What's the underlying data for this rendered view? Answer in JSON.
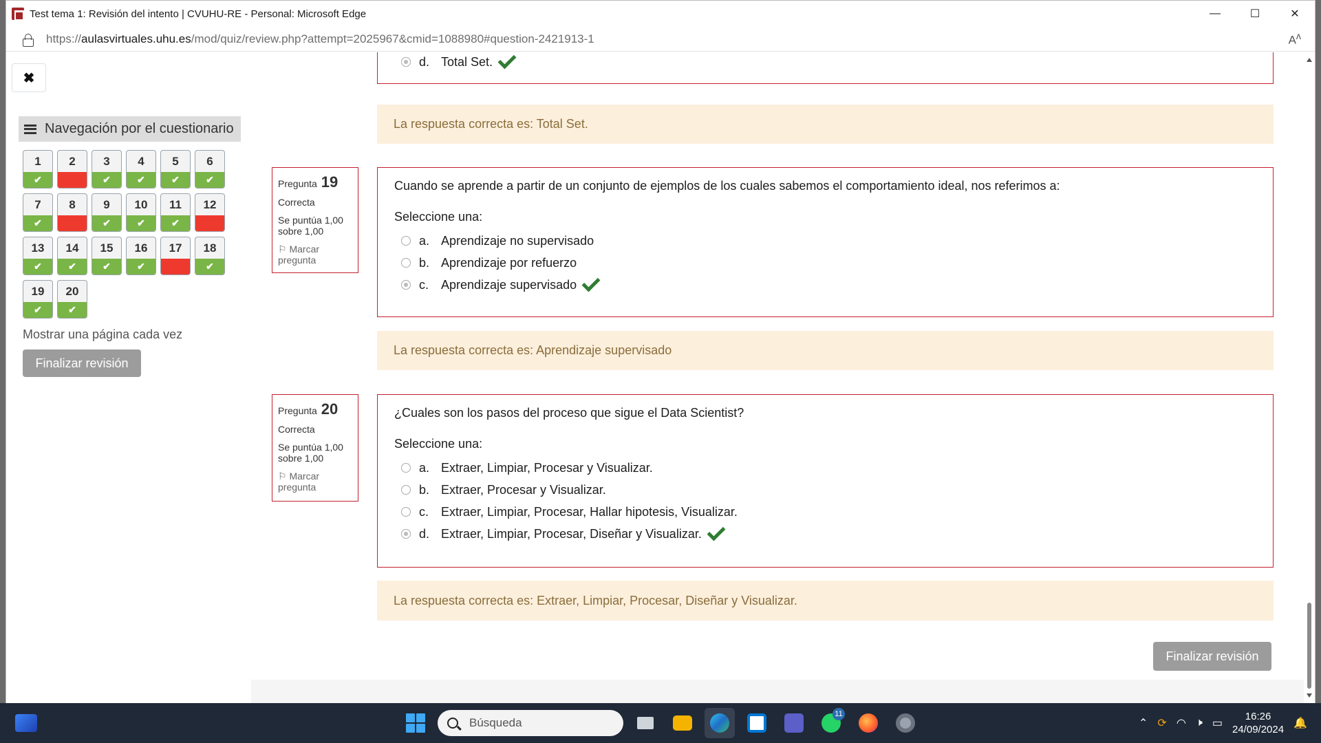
{
  "browser": {
    "title": "Test tema 1: Revisión del intento | CVUHU-RE - Personal: Microsoft Edge",
    "url_prefix": "https://",
    "url_host": "aulasvirtuales.uhu.es",
    "url_path": "/mod/quiz/review.php?attempt=2025967&cmid=1088980#question-2421913-1",
    "minimize": "—",
    "maximize": "☐",
    "close": "✕",
    "read_aloud": "Aͅ"
  },
  "drawer": {
    "close_label": "✖",
    "nav_title": "Navegación por el cuestionario",
    "questions": [
      {
        "n": "1",
        "status": "correct"
      },
      {
        "n": "2",
        "status": "incorrect"
      },
      {
        "n": "3",
        "status": "correct"
      },
      {
        "n": "4",
        "status": "correct"
      },
      {
        "n": "5",
        "status": "correct"
      },
      {
        "n": "6",
        "status": "correct"
      },
      {
        "n": "7",
        "status": "correct"
      },
      {
        "n": "8",
        "status": "incorrect"
      },
      {
        "n": "9",
        "status": "correct"
      },
      {
        "n": "10",
        "status": "correct"
      },
      {
        "n": "11",
        "status": "correct"
      },
      {
        "n": "12",
        "status": "incorrect"
      },
      {
        "n": "13",
        "status": "correct"
      },
      {
        "n": "14",
        "status": "correct"
      },
      {
        "n": "15",
        "status": "correct"
      },
      {
        "n": "16",
        "status": "correct"
      },
      {
        "n": "17",
        "status": "incorrect"
      },
      {
        "n": "18",
        "status": "correct"
      },
      {
        "n": "19",
        "status": "correct"
      },
      {
        "n": "20",
        "status": "correct"
      }
    ],
    "show_one_page": "Mostrar una página cada vez",
    "finish_label": "Finalizar revisión"
  },
  "prev_question": {
    "answer_letter": "d.",
    "answer_text": "Total Set.",
    "feedback": "La respuesta correcta es: Total Set."
  },
  "q19": {
    "label": "Pregunta",
    "number": "19",
    "state": "Correcta",
    "grade_line1": "Se puntúa 1,00",
    "grade_line2": "sobre 1,00",
    "flag_line1": "Marcar",
    "flag_line2": "pregunta",
    "text": "Cuando se aprende a partir de un conjunto de ejemplos de los cuales sabemos el comportamiento ideal, nos referimos a:",
    "prompt": "Seleccione una:",
    "answers": [
      {
        "letter": "a.",
        "text": "Aprendizaje no supervisado"
      },
      {
        "letter": "b.",
        "text": "Aprendizaje por refuerzo"
      },
      {
        "letter": "c.",
        "text": "Aprendizaje supervisado"
      }
    ],
    "feedback": "La respuesta correcta es: Aprendizaje supervisado"
  },
  "q20": {
    "label": "Pregunta",
    "number": "20",
    "state": "Correcta",
    "grade_line1": "Se puntúa 1,00",
    "grade_line2": "sobre 1,00",
    "flag_line1": "Marcar",
    "flag_line2": "pregunta",
    "text": "¿Cuales son los pasos del proceso que sigue el Data Scientist?",
    "prompt": "Seleccione una:",
    "answers": [
      {
        "letter": "a.",
        "text": "Extraer, Limpiar, Procesar y Visualizar."
      },
      {
        "letter": "b.",
        "text": "Extraer, Procesar y Visualizar."
      },
      {
        "letter": "c.",
        "text": "Extraer, Limpiar, Procesar, Hallar hipotesis, Visualizar."
      },
      {
        "letter": "d.",
        "text": "Extraer, Limpiar, Procesar, Diseñar y Visualizar."
      }
    ],
    "feedback": "La respuesta correcta es: Extraer, Limpiar, Procesar, Diseñar y Visualizar."
  },
  "finish_bottom": "Finalizar revisión",
  "taskbar": {
    "search_placeholder": "Búsqueda",
    "whatsapp_badge": "11",
    "time": "16:26",
    "date": "24/09/2024"
  },
  "colors": {
    "correct": "#7ab547",
    "incorrect": "#ee3a2e",
    "question_border": "#c21f2c",
    "feedback_bg": "#fcefdc",
    "feedback_text": "#8a6d3b"
  }
}
